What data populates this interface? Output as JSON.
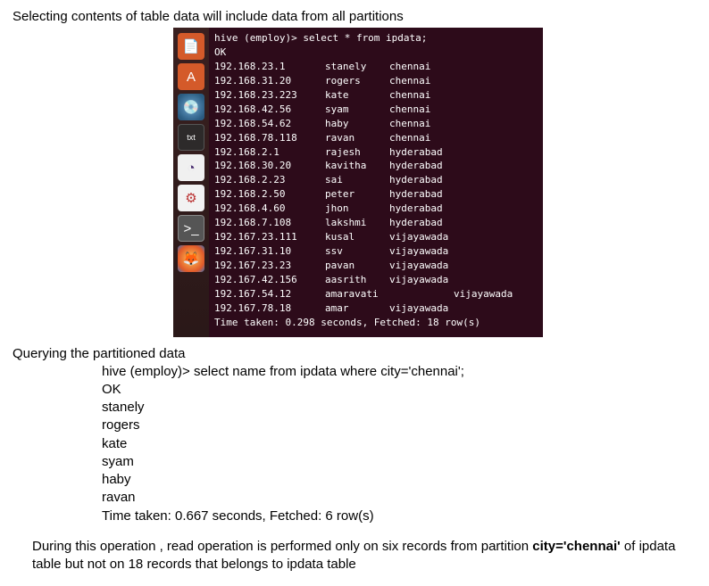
{
  "heading1": "Selecting contents of table data will include data from all partitions",
  "terminal": {
    "prompt": "hive (employ)> select * from ipdata;",
    "ok": "OK",
    "rows": [
      {
        "ip": "192.168.23.1",
        "name": "stanely",
        "city": "chennai"
      },
      {
        "ip": "192.168.31.20",
        "name": "rogers",
        "city": "chennai"
      },
      {
        "ip": "192.168.23.223",
        "name": "kate",
        "city": "chennai"
      },
      {
        "ip": "192.168.42.56",
        "name": "syam",
        "city": "chennai"
      },
      {
        "ip": "192.168.54.62",
        "name": "haby",
        "city": "chennai"
      },
      {
        "ip": "192.168.78.118",
        "name": "ravan",
        "city": "chennai"
      },
      {
        "ip": "192.168.2.1",
        "name": "rajesh",
        "city": "hyderabad"
      },
      {
        "ip": "192.168.30.20",
        "name": "kavitha",
        "city": "hyderabad"
      },
      {
        "ip": "192.168.2.23",
        "name": "sai",
        "city": "hyderabad"
      },
      {
        "ip": "192.168.2.50",
        "name": "peter",
        "city": "hyderabad"
      },
      {
        "ip": "192.168.4.60",
        "name": "jhon",
        "city": "hyderabad"
      },
      {
        "ip": "192.168.7.108",
        "name": "lakshmi",
        "city": "hyderabad"
      },
      {
        "ip": "192.167.23.111",
        "name": "kusal",
        "city": "vijayawada"
      },
      {
        "ip": "192.167.31.10",
        "name": "ssv",
        "city": "vijayawada"
      },
      {
        "ip": "192.167.23.23",
        "name": "pavan",
        "city": "vijayawada"
      },
      {
        "ip": "192.167.42.156",
        "name": "aasrith",
        "city": "vijayawada"
      },
      {
        "ip": "192.167.54.12",
        "name": "amaravati",
        "city": "vijayawada",
        "offset": true
      },
      {
        "ip": "192.167.78.18",
        "name": "amar",
        "city": "vijayawada"
      }
    ],
    "footer": "Time taken: 0.298 seconds, Fetched: 18 row(s)"
  },
  "heading2": "Querying  the partitioned data",
  "query": {
    "cmd": "hive (employ)> select name from ipdata where city='chennai';",
    "ok": "OK",
    "names": [
      "stanely",
      "rogers",
      "kate",
      "syam",
      "haby",
      "ravan"
    ],
    "footer": "Time taken: 0.667 seconds, Fetched: 6 row(s)"
  },
  "para_before": "During this operation , read operation is performed only on six records from partition ",
  "para_bold": "city='chennai'",
  "para_after": " of ipdata table  but not on 18 records that belongs to ipdata table",
  "launcher": {
    "icons": [
      "impress",
      "software",
      "music",
      "text",
      "eclipse",
      "settings",
      "terminal",
      "firefox"
    ]
  }
}
